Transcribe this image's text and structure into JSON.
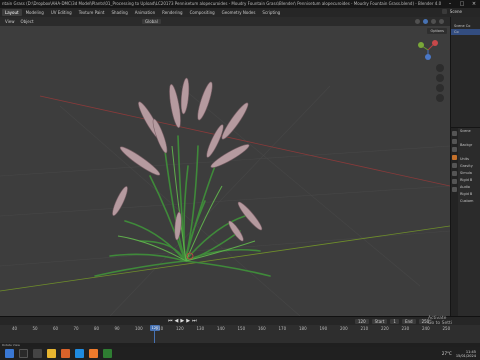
{
  "window": {
    "title": "ntain Grass (D:\\Dropbox\\AHA-DMC\\3d Model\\Plants\\01_Processing to Upload\\LC20173 Pennisetum alopecuroides - Moudry Fountain Grass\\Blender\\ Pennisetum alopecuroides - Moudry Fountain Grass.blend) - Blender 4.0"
  },
  "menu": {
    "items": [
      "Layout",
      "Modeling",
      "UV Editing",
      "Texture Paint",
      "Shading",
      "Animation",
      "Rendering",
      "Compositing",
      "Geometry Nodes",
      "Scripting"
    ],
    "scene_label": "Scene"
  },
  "viewport_header": {
    "view": "View",
    "object": "Object",
    "orientation": "Global",
    "options": "Options"
  },
  "outliner": {
    "rows": [
      "Scene Co",
      "Co",
      "",
      ""
    ]
  },
  "properties": {
    "rows": [
      "Scene",
      "",
      "Backgr",
      "",
      "Units",
      "Gravity",
      "Simula",
      "Rigid B",
      "Audio",
      "Rigid B",
      "Custom"
    ]
  },
  "timeline": {
    "ticks": [
      "40",
      "50",
      "60",
      "70",
      "80",
      "90",
      "100",
      "110",
      "120",
      "130",
      "140",
      "150",
      "160",
      "170",
      "180",
      "190",
      "200",
      "210",
      "220",
      "230",
      "240",
      "250"
    ],
    "current_frame": "120",
    "start_label": "Start",
    "start": "1",
    "end_label": "End",
    "end": "250"
  },
  "statusbar": {
    "text": "Rotate View"
  },
  "activate": {
    "line1": "Activate",
    "line2": "Go to Setti"
  },
  "taskbar": {
    "temp": "27°C",
    "time": "11:45",
    "date": "15/01/2024"
  }
}
